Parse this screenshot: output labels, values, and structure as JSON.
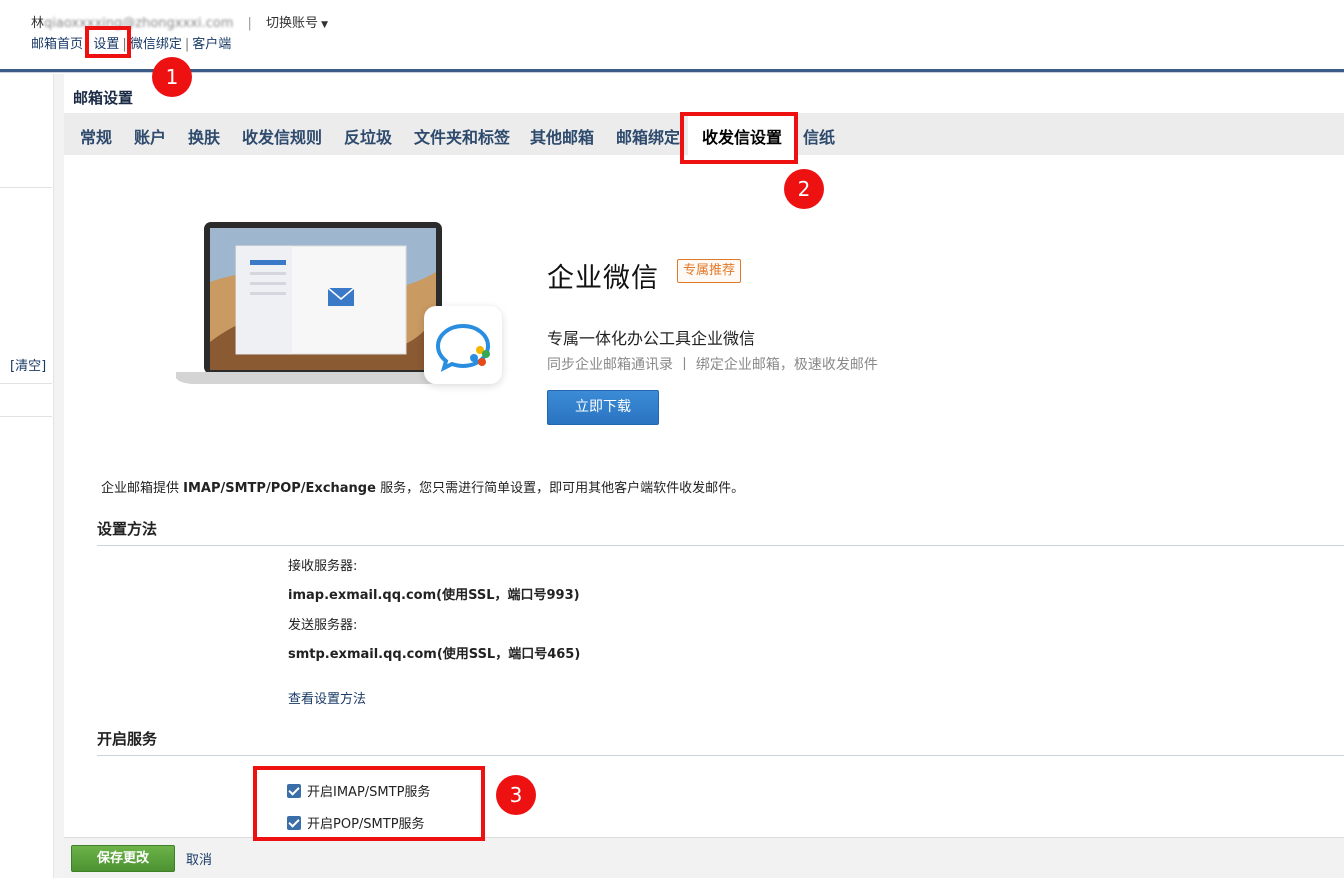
{
  "top": {
    "account_name": "林",
    "account_email": "qiaoxxxxing@zhongxxxi.com",
    "switch_account": "切换账号",
    "links": [
      "邮箱首页",
      "设置",
      "微信绑定",
      "客户端"
    ]
  },
  "sidebar": {
    "clear_link": "[清空]"
  },
  "main": {
    "page_title": "邮箱设置",
    "tabs": [
      "常规",
      "账户",
      "换肤",
      "收发信规则",
      "反垃圾",
      "文件夹和标签",
      "其他邮箱",
      "邮箱绑定",
      "收发信设置",
      "信纸"
    ],
    "active_tab": "收发信设置"
  },
  "promo": {
    "title": "企业微信",
    "badge": "专属推荐",
    "subtitle": "专属一体化办公工具企业微信",
    "desc": "同步企业邮箱通讯录 丨 绑定企业邮箱，极速收发邮件",
    "download": "立即下载"
  },
  "intro": {
    "prefix": "企业邮箱提供 ",
    "protocols": "IMAP/SMTP/POP/Exchange",
    "suffix": " 服务，您只需进行简单设置，即可用其他客户端软件收发邮件。"
  },
  "setup": {
    "heading": "设置方法",
    "incoming_label": "接收服务器:",
    "incoming_value": "imap.exmail.qq.com(使用SSL，端口号993)",
    "outgoing_label": "发送服务器:",
    "outgoing_value": "smtp.exmail.qq.com(使用SSL，端口号465)",
    "view_link": "查看设置方法"
  },
  "services": {
    "heading": "开启服务",
    "imap": {
      "label": "开启IMAP/SMTP服务",
      "checked": true
    },
    "pop": {
      "label": "开启POP/SMTP服务",
      "checked": true
    }
  },
  "footer": {
    "save": "保存更改",
    "cancel": "取消"
  },
  "annotations": {
    "markers": [
      "1",
      "2",
      "3"
    ],
    "color": "#ee1111"
  },
  "colors": {
    "nav_text": "#2e4a6c",
    "link": "#1a3a66",
    "save_green": "#5aa43c",
    "download_blue": "#2a74c2",
    "badge_orange": "#e07a2a"
  }
}
